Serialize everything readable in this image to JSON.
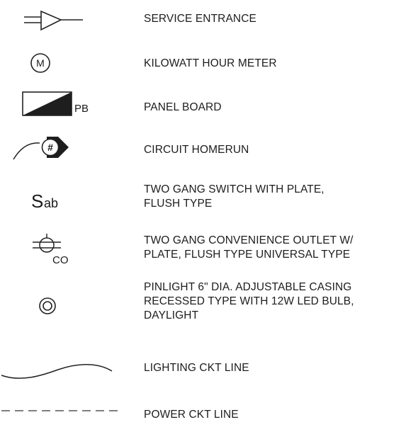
{
  "legend": {
    "rows": [
      {
        "symbol": "service-entrance-symbol",
        "lines": [
          "SERVICE ENTRANCE"
        ]
      },
      {
        "symbol": "kilowatt-hour-meter-symbol",
        "symbol_text": "M",
        "lines": [
          "KILOWATT HOUR METER"
        ]
      },
      {
        "symbol": "panel-board-symbol",
        "symbol_text": "PB",
        "lines": [
          "PANEL BOARD"
        ]
      },
      {
        "symbol": "circuit-homerun-symbol",
        "symbol_text": "#",
        "lines": [
          "CIRCUIT HOMERUN"
        ]
      },
      {
        "symbol": "two-gang-switch-symbol",
        "symbol_text_main": "S",
        "symbol_text_sub": "ab",
        "lines": [
          "TWO GANG SWITCH WITH PLATE,",
          "FLUSH TYPE"
        ]
      },
      {
        "symbol": "convenience-outlet-symbol",
        "symbol_text": "CO",
        "lines": [
          "TWO GANG CONVENIENCE OUTLET W/",
          "PLATE, FLUSH TYPE UNIVERSAL TYPE"
        ]
      },
      {
        "symbol": "pinlight-symbol",
        "lines": [
          "PINLIGHT 6\" DIA. ADJUSTABLE CASING",
          "RECESSED TYPE WITH 12W LED BULB,",
          "DAYLIGHT"
        ]
      },
      {
        "symbol": "lighting-ckt-line-symbol",
        "lines": [
          "LIGHTING CKT LINE"
        ]
      },
      {
        "symbol": "power-ckt-line-symbol",
        "lines": [
          "POWER CKT LINE"
        ]
      }
    ]
  }
}
